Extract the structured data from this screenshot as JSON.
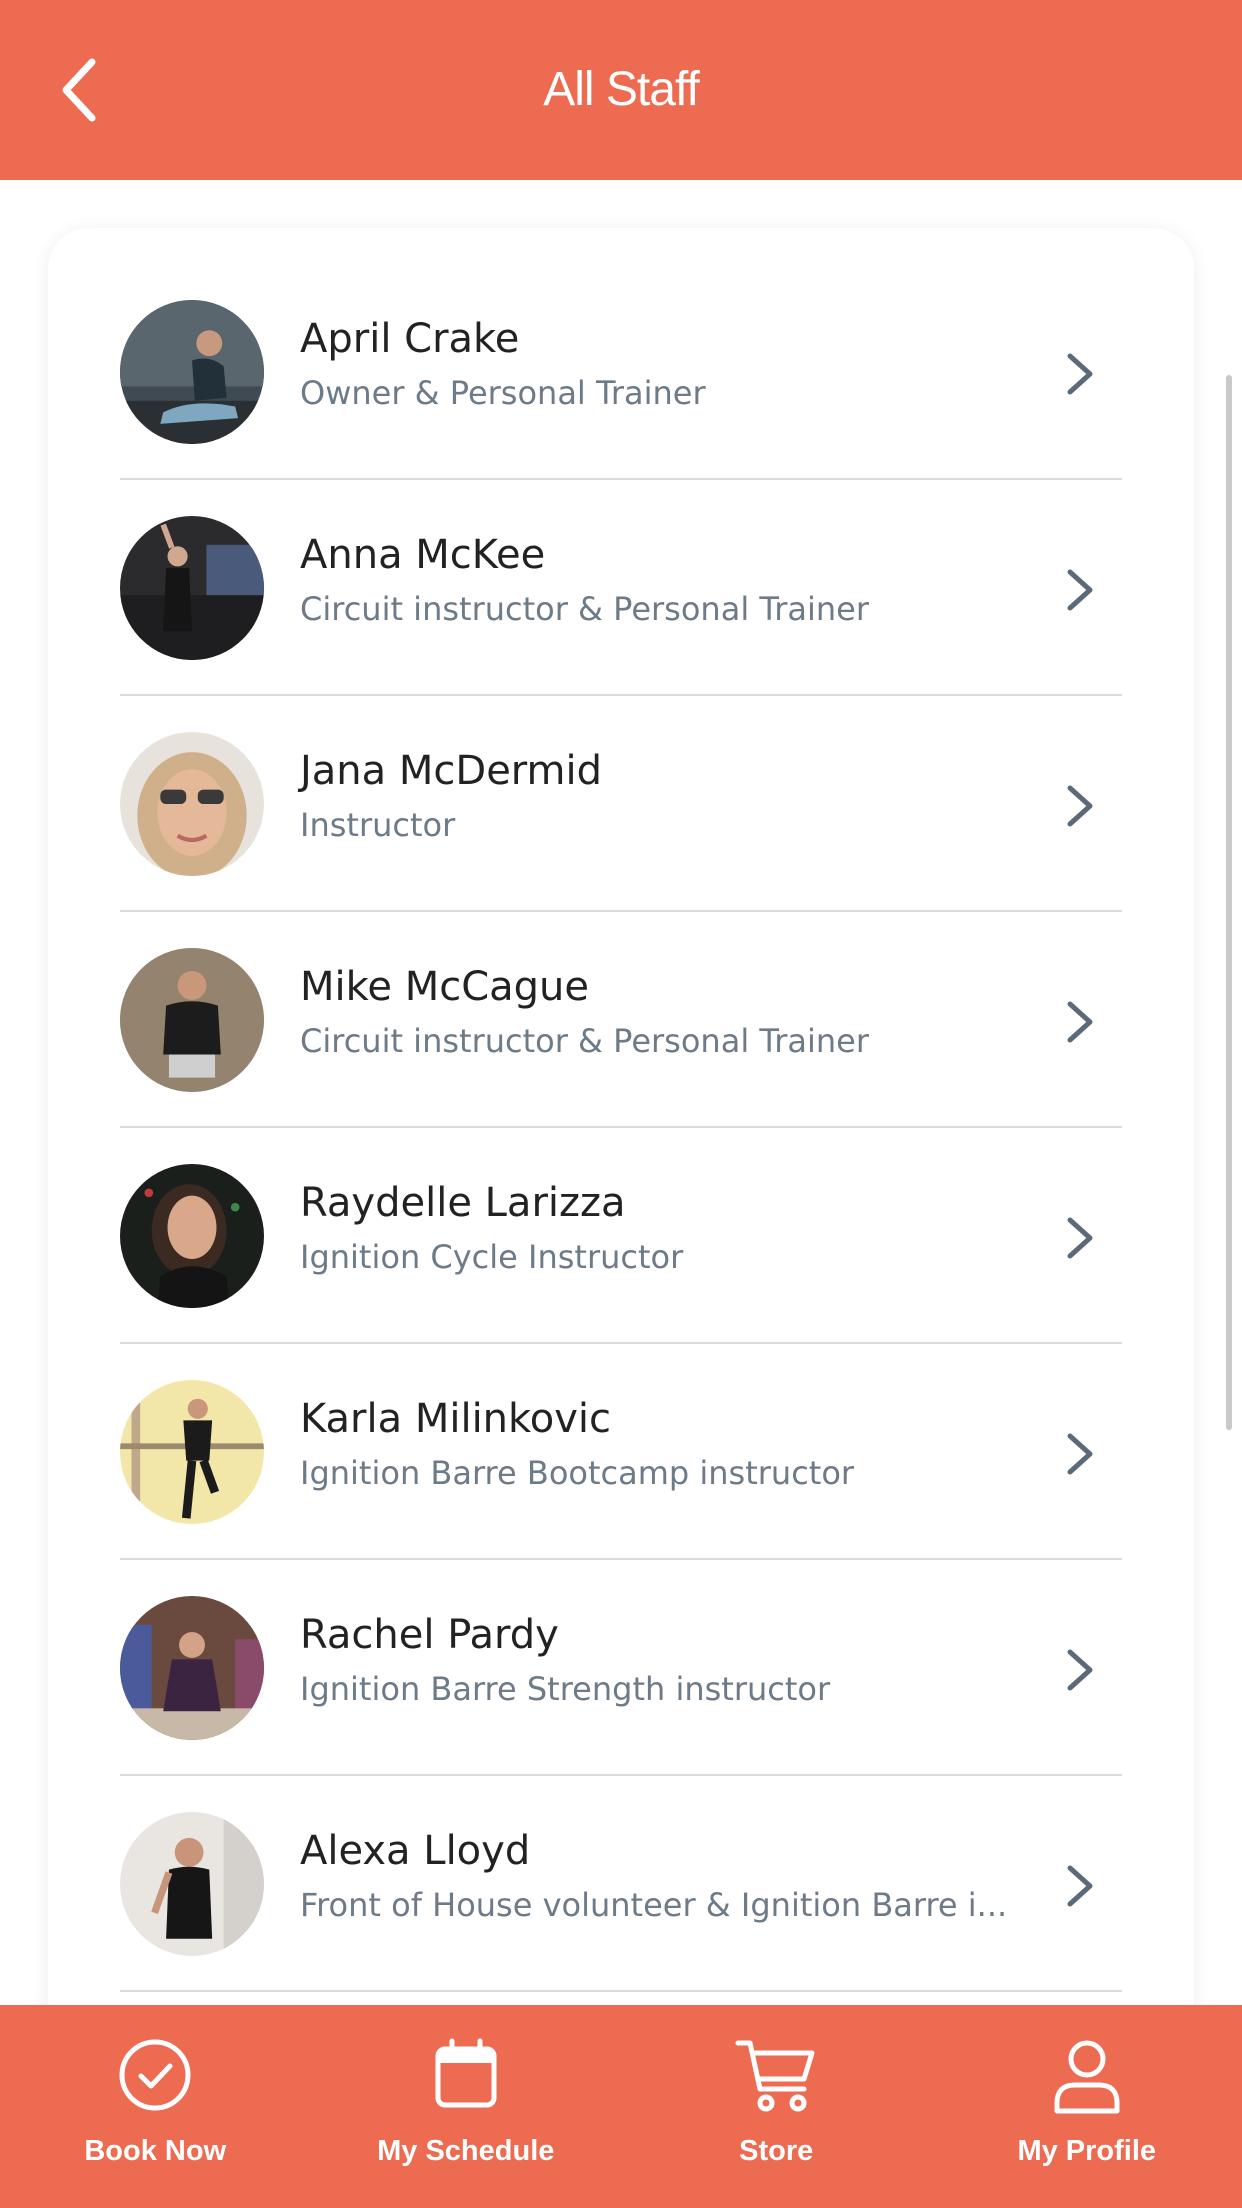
{
  "header": {
    "title": "All Staff"
  },
  "staff": [
    {
      "name": "April Crake",
      "role": "Owner & Personal Trainer"
    },
    {
      "name": "Anna McKee",
      "role": "Circuit instructor & Personal Trainer"
    },
    {
      "name": "Jana McDermid",
      "role": "Instructor"
    },
    {
      "name": "Mike McCague",
      "role": "Circuit instructor & Personal Trainer"
    },
    {
      "name": "Raydelle Larizza",
      "role": "Ignition Cycle Instructor"
    },
    {
      "name": "Karla Milinkovic",
      "role": "Ignition Barre Bootcamp instructor"
    },
    {
      "name": "Rachel Pardy",
      "role": "Ignition Barre Strength instructor"
    },
    {
      "name": "Alexa Lloyd",
      "role": "Front of House volunteer & Ignition Barre i..."
    }
  ],
  "tabbar": {
    "tabs": [
      {
        "label": "Book Now",
        "icon": "check-circle-icon"
      },
      {
        "label": "My Schedule",
        "icon": "calendar-icon"
      },
      {
        "label": "Store",
        "icon": "cart-icon"
      },
      {
        "label": "My Profile",
        "icon": "user-icon"
      }
    ]
  },
  "colors": {
    "accent": "#ec6b51",
    "name_text": "#222222",
    "role_text": "#6d7b88",
    "divider": "#d9dde2"
  }
}
